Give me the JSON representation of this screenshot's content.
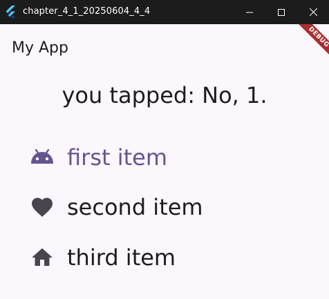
{
  "window": {
    "title": "chapter_4_1_20250604_4_4"
  },
  "appbar": {
    "title": "My App",
    "debug_banner": "DEBUG"
  },
  "main": {
    "tapped_text": "you tapped: No, 1.",
    "items": [
      {
        "label": "first item",
        "icon": "android-icon",
        "selected": true
      },
      {
        "label": "second item",
        "icon": "heart-icon",
        "selected": false
      },
      {
        "label": "third item",
        "icon": "home-icon",
        "selected": false
      }
    ]
  },
  "colors": {
    "accent": "#65558f",
    "text": "#1d1b20",
    "background": "#fcf7fd",
    "titlebar": "#1c1c1c",
    "debug": "#a82f30"
  }
}
